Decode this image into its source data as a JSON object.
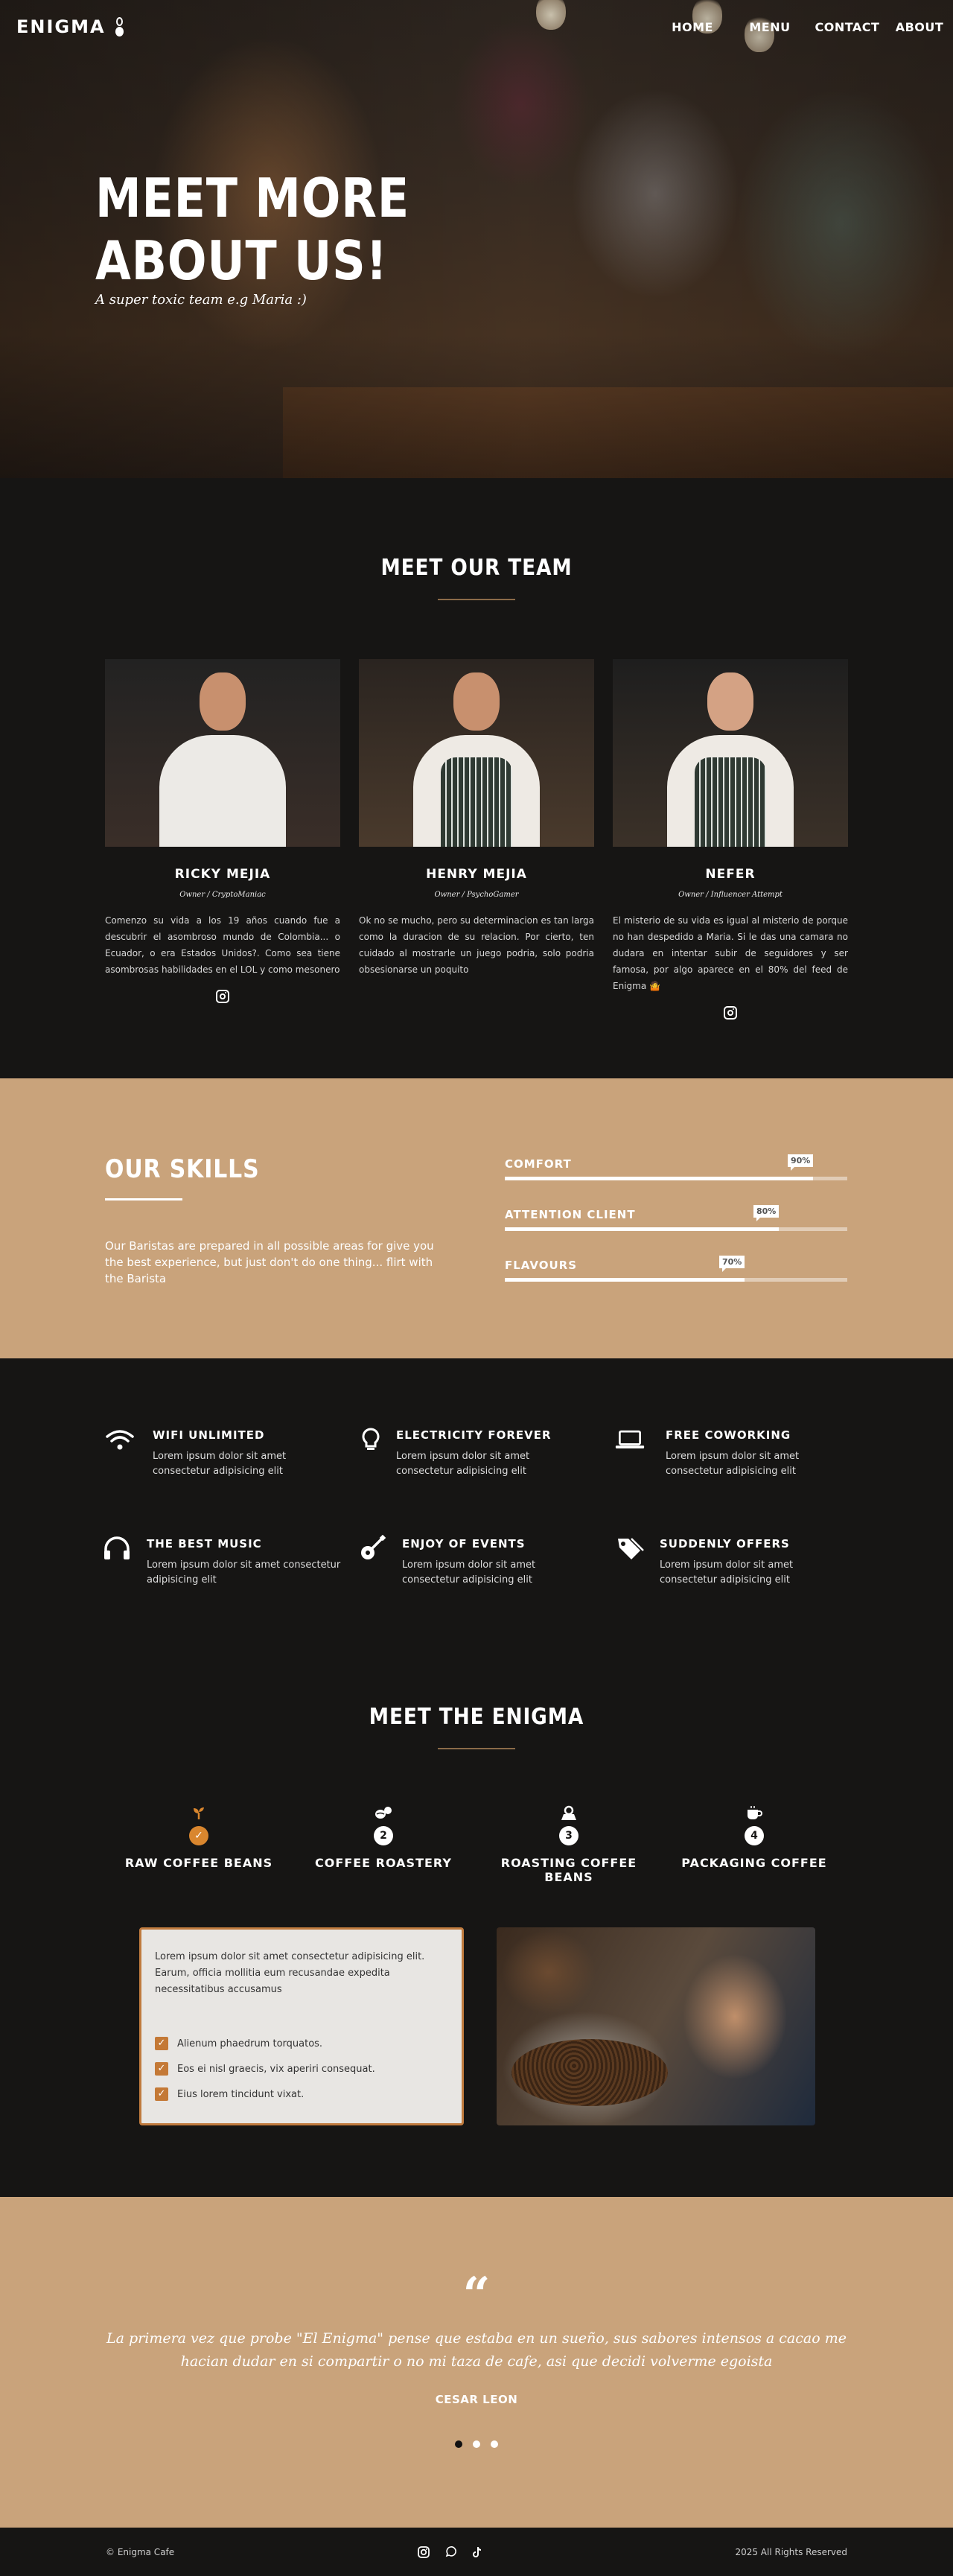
{
  "brand": {
    "name": "ENIGMA"
  },
  "nav": {
    "items": [
      "HOME",
      "MENU",
      "CONTACT",
      "ABOUT"
    ]
  },
  "hero": {
    "title_line1": "MEET MORE",
    "title_line2": "ABOUT US!",
    "subtitle": "A super toxic team e.g Maria :)"
  },
  "team": {
    "title": "MEET OUR TEAM",
    "members": [
      {
        "name": "RICKY MEJIA",
        "role": "Owner / CryptoManiac",
        "bio": "Comenzo su vida a los 19 años cuando fue a descubrir el asombroso mundo de Colombia... o Ecuador, o era Estados Unidos?. Como sea tiene asombrosas habilidades en el LOL y como mesonero"
      },
      {
        "name": "HENRY MEJIA",
        "role": "Owner / PsychoGamer",
        "bio": "Ok no se mucho, pero su determinacion es tan larga como la duracion de su relacion. Por cierto, ten cuidado al mostrarle un juego podria, solo podria obsesionarse un poquito"
      },
      {
        "name": "NEFER",
        "role": "Owner / Influencer Attempt",
        "bio": "El misterio de su vida es igual al misterio de porque no han despedido a Maria. Si le das una camara no dudara en intentar subir de seguidores y ser famosa, por algo aparece en el 80% del feed de Enigma 🤷"
      }
    ]
  },
  "skills": {
    "title": "OUR SKILLS",
    "description": "Our Baristas are prepared in all possible areas for give you the best experience, but just don't do one thing... flirt with the Barista",
    "items": [
      {
        "label": "COMFORT",
        "percent": 90,
        "display": "90%"
      },
      {
        "label": "ATTENTION CLIENT",
        "percent": 80,
        "display": "80%"
      },
      {
        "label": "FLAVOURS",
        "percent": 70,
        "display": "70%"
      }
    ]
  },
  "features": [
    {
      "title": "WIFI UNLIMITED",
      "text": "Lorem ipsum dolor sit amet consectetur adipisicing elit",
      "icon": "wifi-icon"
    },
    {
      "title": "ELECTRICITY FOREVER",
      "text": "Lorem ipsum dolor sit amet consectetur adipisicing elit",
      "icon": "lightbulb-icon"
    },
    {
      "title": "FREE COWORKING",
      "text": "Lorem ipsum dolor sit amet consectetur adipisicing elit",
      "icon": "laptop-icon"
    },
    {
      "title": "THE BEST MUSIC",
      "text": "Lorem ipsum dolor sit amet consectetur adipisicing elit",
      "icon": "headphones-icon"
    },
    {
      "title": "ENJOY OF EVENTS",
      "text": "Lorem ipsum dolor sit amet consectetur adipisicing elit",
      "icon": "guitar-icon"
    },
    {
      "title": "SUDDENLY OFFERS",
      "text": "Lorem ipsum dolor sit amet consectetur adipisicing elit",
      "icon": "tags-icon"
    }
  ],
  "enigma": {
    "title": "MEET THE ENIGMA",
    "steps": [
      {
        "label": "RAW COFFEE BEANS",
        "number": "✓",
        "icon": "sprout-icon"
      },
      {
        "label": "COFFEE ROASTERY",
        "number": "2",
        "icon": "beans-icon"
      },
      {
        "label": "ROASTING COFFEE BEANS",
        "number": "3",
        "icon": "roaster-icon"
      },
      {
        "label": "PACKAGING COFFEE",
        "number": "4",
        "icon": "cup-icon"
      }
    ],
    "card": {
      "paragraph": "Lorem ipsum dolor sit amet consectetur adipisicing elit. Earum, officia mollitia eum recusandae expedita necessitatibus accusamus",
      "list": [
        "Alienum phaedrum torquatos.",
        "Eos ei nisl graecis, vix aperiri consequat.",
        "Eius lorem tincidunt vixat."
      ]
    }
  },
  "testimonial": {
    "quote": "La primera vez que probe \"El Enigma\" pense que estaba en un sueño, sus sabores intensos a cacao me hacian dudar en si compartir o no mi taza de cafe, asi que decidi volverme egoista",
    "author": "CESAR LEON",
    "slides": 3,
    "active_slide": 1
  },
  "footer": {
    "left": "© Enigma Cafe",
    "right": "2025 All Rights Reserved",
    "socials": [
      "instagram-icon",
      "whatsapp-icon",
      "tiktok-icon"
    ]
  },
  "colors": {
    "accent": "#c9a37b",
    "dark": "#161514",
    "orange": "#d9862e"
  }
}
